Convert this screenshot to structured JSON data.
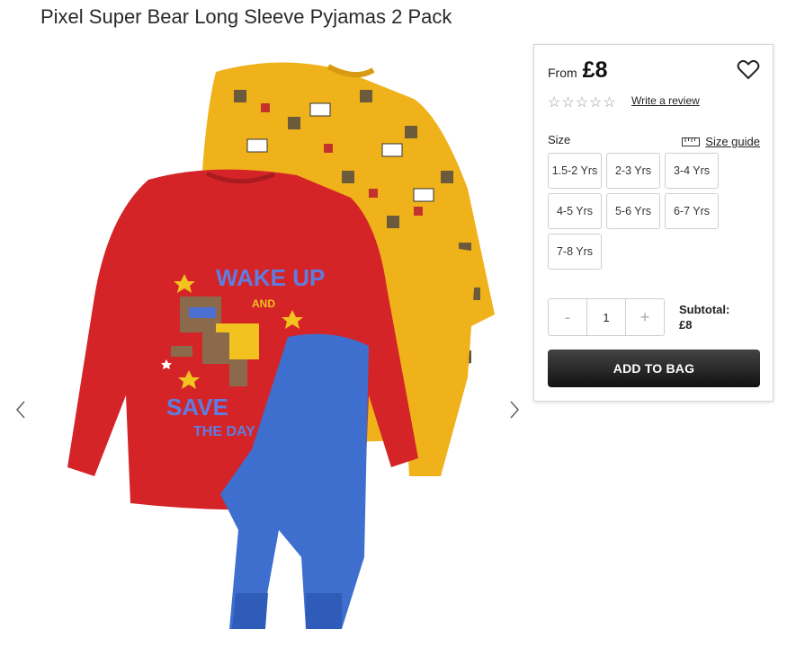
{
  "product": {
    "title": "Pixel Super Bear Long Sleeve Pyjamas 2 Pack"
  },
  "gallery": {
    "prev_icon": "chevron-left-icon",
    "next_icon": "chevron-right-icon",
    "graphic_text": {
      "line1": "WAKE UP",
      "line2": "AND",
      "line3": "SAVE",
      "line4": "THE DAY"
    }
  },
  "purchase": {
    "from_label": "From",
    "price": "£8",
    "wishlist_icon": "heart-icon",
    "rating_icon": "star-outline-icon",
    "review_link": "Write a review",
    "size_label": "Size",
    "size_guide_label": "Size guide",
    "sizes": [
      "1.5-2 Yrs",
      "2-3 Yrs",
      "3-4 Yrs",
      "4-5 Yrs",
      "5-6 Yrs",
      "6-7 Yrs",
      "7-8 Yrs"
    ],
    "quantity": {
      "minus": "-",
      "value": "1",
      "plus": "+"
    },
    "subtotal_label": "Subtotal:",
    "subtotal_value": "£8",
    "add_to_bag": "ADD TO BAG"
  },
  "colors": {
    "shirt_red": "#d42428",
    "shirt_yellow": "#efb21a",
    "pants_blue": "#3f6fce",
    "button_dark": "#222222"
  }
}
